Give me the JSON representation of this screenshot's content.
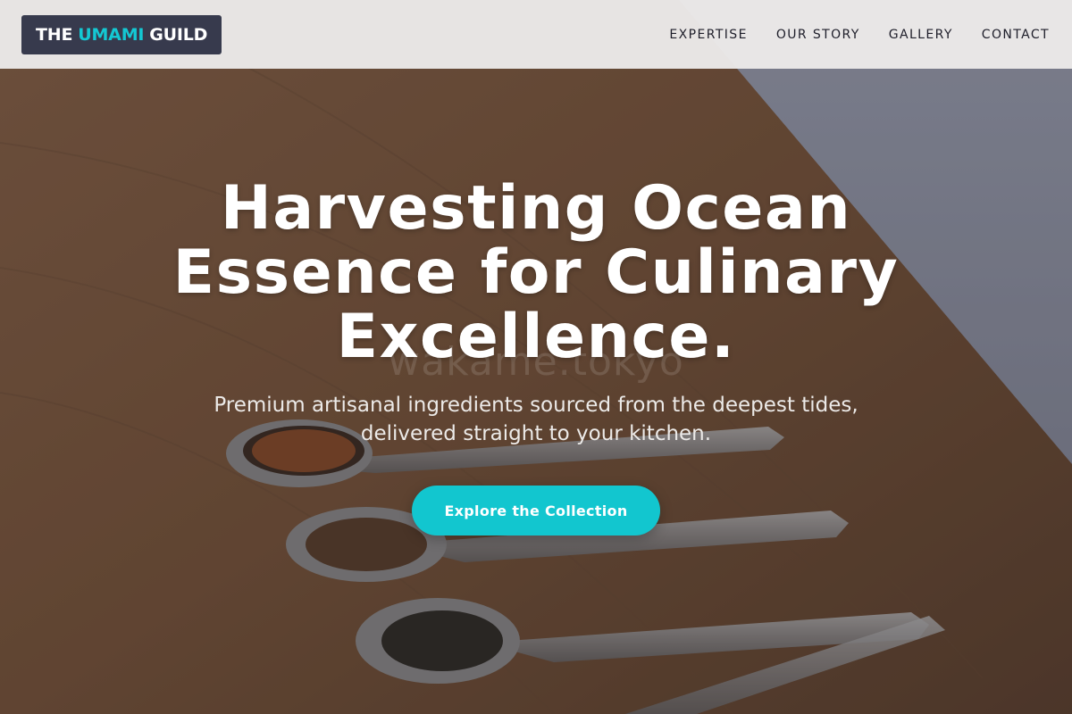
{
  "header": {
    "logo": {
      "part1": "THE",
      "accent": "UMAMI",
      "part2": "GUILD"
    },
    "nav": [
      {
        "label": "EXPERTISE"
      },
      {
        "label": "OUR STORY"
      },
      {
        "label": "GALLERY"
      },
      {
        "label": "CONTACT"
      }
    ]
  },
  "hero": {
    "title": "Harvesting Ocean Essence for Culinary Excellence.",
    "watermark": "wakame.tokyo",
    "subtitle": "Premium artisanal ingredients sourced from the deepest tides, delivered straight to your kitchen.",
    "cta_label": "Explore the Collection",
    "background": "photo of spoons with dried seaweed spices on a wooden table"
  },
  "colors": {
    "accent": "#12c6cf",
    "logo_bg": "#373a4d",
    "header_bg": "#ecebeb",
    "nav_text": "#1e1e2a"
  }
}
